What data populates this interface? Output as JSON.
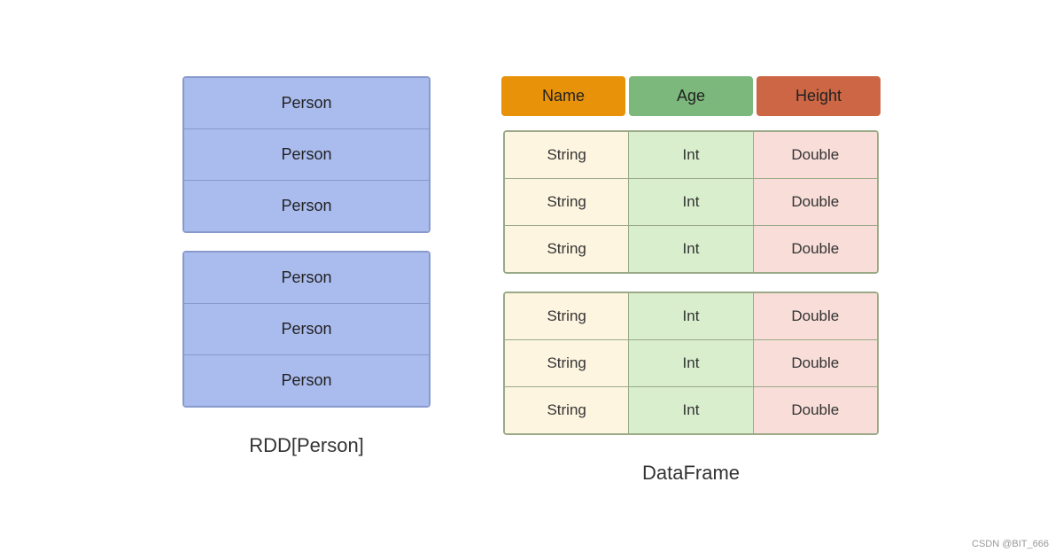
{
  "left": {
    "label": "RDD[Person]",
    "blocks": [
      {
        "rows": [
          "Person",
          "Person",
          "Person"
        ]
      },
      {
        "rows": [
          "Person",
          "Person",
          "Person"
        ]
      }
    ]
  },
  "right": {
    "label": "DataFrame",
    "header": {
      "name": "Name",
      "age": "Age",
      "height": "Height"
    },
    "tables": [
      {
        "rows": [
          {
            "name": "String",
            "age": "Int",
            "height": "Double"
          },
          {
            "name": "String",
            "age": "Int",
            "height": "Double"
          },
          {
            "name": "String",
            "age": "Int",
            "height": "Double"
          }
        ]
      },
      {
        "rows": [
          {
            "name": "String",
            "age": "Int",
            "height": "Double"
          },
          {
            "name": "String",
            "age": "Int",
            "height": "Double"
          },
          {
            "name": "String",
            "age": "Int",
            "height": "Double"
          }
        ]
      }
    ]
  },
  "watermark": "CSDN @BIT_666"
}
